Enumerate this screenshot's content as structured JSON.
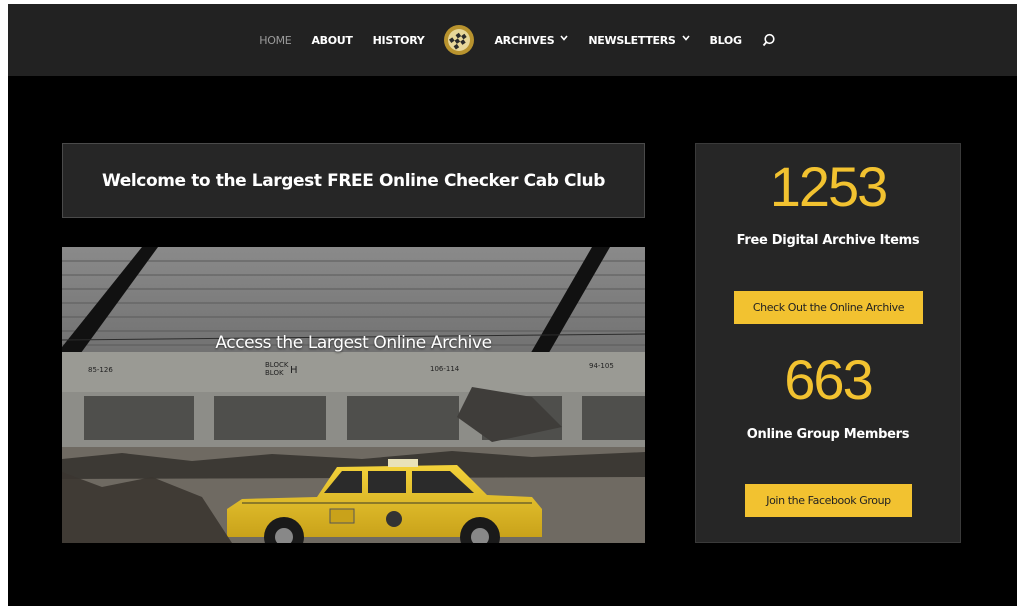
{
  "nav": {
    "items": [
      {
        "label": "HOME",
        "active": true
      },
      {
        "label": "ABOUT"
      },
      {
        "label": "HISTORY"
      },
      {
        "label": "ARCHIVES",
        "dropdown": true
      },
      {
        "label": "NEWSLETTERS",
        "dropdown": true
      },
      {
        "label": "BLOG"
      }
    ],
    "chevron": "⌄"
  },
  "welcome": {
    "title": "Welcome to the Largest FREE Online Checker Cab Club"
  },
  "hero": {
    "caption": "Access the Largest Online Archive"
  },
  "stats": {
    "archive_count": "1253",
    "archive_label": "Free Digital Archive Items",
    "archive_button": "Check Out the Online Archive",
    "members_count": "663",
    "members_label": "Online Group Members",
    "members_button": "Join the Facebook Group"
  },
  "colors": {
    "accent": "#f2c230",
    "nav_bg": "#222222",
    "panel_bg": "#262626",
    "page_bg": "#000000"
  }
}
